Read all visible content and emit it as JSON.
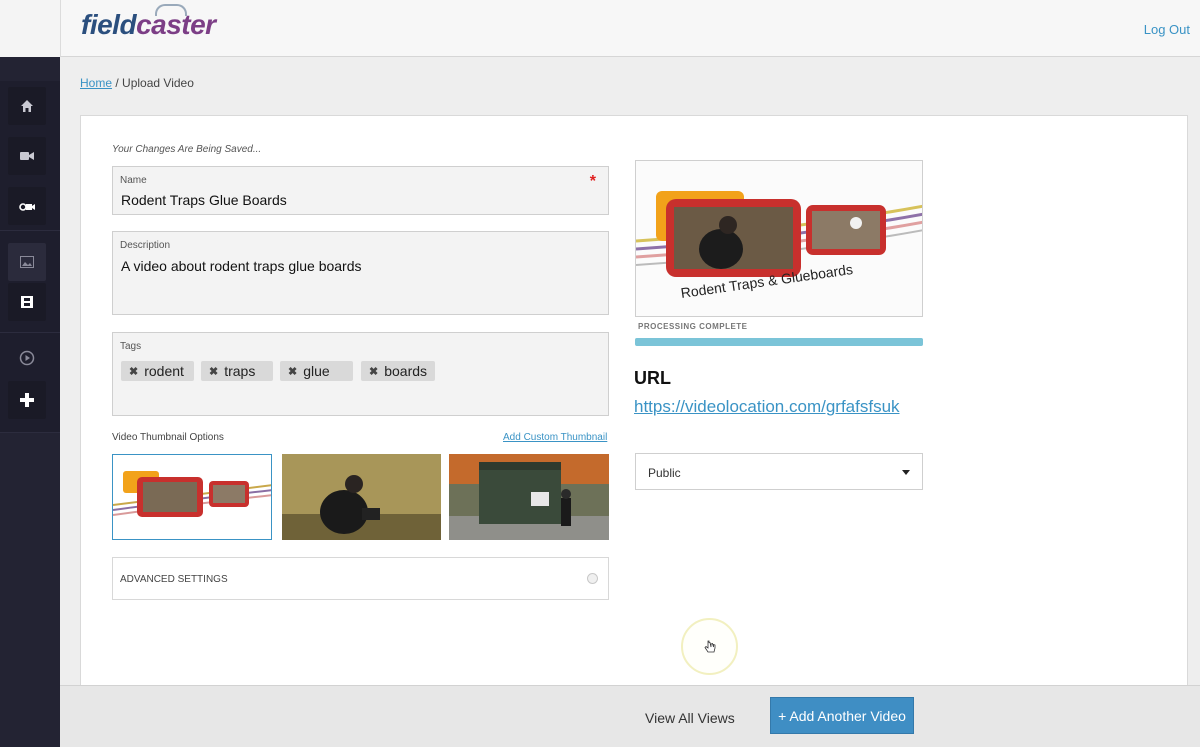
{
  "app": {
    "logo_part1": "field",
    "logo_part2": "caster",
    "logout_label": "Log Out"
  },
  "colors": {
    "accent": "#3a93c5",
    "sidebar_bg": "#232333",
    "primary_button": "#3f8ec4",
    "required_marker": "#e02020"
  },
  "sidebar": {
    "items": [
      {
        "icon": "home-icon"
      },
      {
        "icon": "video-camera-icon"
      },
      {
        "icon": "camcorder-icon"
      },
      {
        "icon": "image-icon"
      },
      {
        "icon": "film-icon"
      },
      {
        "icon": "play-circle-icon"
      },
      {
        "icon": "plus-icon"
      }
    ]
  },
  "breadcrumb": {
    "home": "Home",
    "separator": "/",
    "current": "Upload Video"
  },
  "form": {
    "saving_status": "Your Changes Are Being Saved...",
    "name": {
      "label": "Name",
      "value": "Rodent Traps Glue Boards",
      "required_marker": "*"
    },
    "description": {
      "label": "Description",
      "value": "A video about rodent traps glue boards"
    },
    "tags": {
      "label": "Tags",
      "remove_glyph": "✖",
      "items": [
        "rodent",
        "traps",
        "glue",
        "boards"
      ]
    },
    "thumbnails": {
      "label": "Video Thumbnail Options",
      "add_custom": "Add Custom Thumbnail",
      "selected_index": 0
    },
    "advanced_label": "ADVANCED SETTINGS"
  },
  "preview": {
    "title_text": "Rodent Traps & Glueboards",
    "status": "PROCESSING COMPLETE",
    "progress": 1.0
  },
  "url": {
    "heading": "URL",
    "link": "https://videolocation.com/grfafsfsuk"
  },
  "visibility": {
    "selected": "Public"
  },
  "footer": {
    "view_all": "View All Views",
    "add_another": "+ Add Another Video"
  }
}
